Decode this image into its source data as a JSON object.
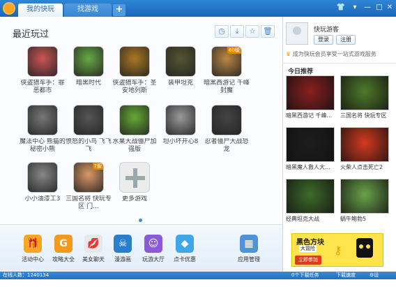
{
  "tabs": [
    "我的快玩",
    "找游戏"
  ],
  "main": {
    "section_title": "最近玩过",
    "games": [
      {
        "name": "侠盗猎车手：罪恶都市",
        "badge": ""
      },
      {
        "name": "暗黑时代",
        "badge": ""
      },
      {
        "name": "侠盗猎车手：圣安地列斯",
        "badge": ""
      },
      {
        "name": "装甲坦克",
        "badge": ""
      },
      {
        "name": "暗黑西游记 千峰封魔",
        "badge": "60级"
      },
      {
        "name": "魔法中心 熊猫的秘密小熊",
        "badge": ""
      },
      {
        "name": "愤怒的小鸟 飞飞飞",
        "badge": ""
      },
      {
        "name": "水果大战僵尸加强版",
        "badge": ""
      },
      {
        "name": "坦小坏开心8",
        "badge": ""
      },
      {
        "name": "忍者僵尸大战恐龙",
        "badge": ""
      },
      {
        "name": "小小油漆工3",
        "badge": ""
      },
      {
        "name": "三国名将 快玩专区 门...",
        "badge": "7服"
      },
      {
        "name": "更多游戏",
        "badge": ""
      }
    ]
  },
  "bottom": [
    {
      "label": "活动中心",
      "icon": "gift-icon",
      "color": "#f5a623",
      "glyph": "🎁"
    },
    {
      "label": "攻略大全",
      "icon": "guide-icon",
      "color": "#f39a1e",
      "glyph": "G"
    },
    {
      "label": "美女聊天",
      "icon": "lips-icon",
      "color": "#e8e8e8",
      "glyph": "💋"
    },
    {
      "label": "漫游画",
      "icon": "pirate-icon",
      "color": "#2b7ec9",
      "glyph": "☠"
    },
    {
      "label": "玩游大厅",
      "icon": "smile-icon",
      "color": "#8b5ad8",
      "glyph": "☺"
    },
    {
      "label": "点卡优惠",
      "icon": "diamond-icon",
      "color": "#3fa6e8",
      "glyph": "◆"
    },
    {
      "label": "应用管理",
      "icon": "apps-grid-icon",
      "color": "#4f92d8",
      "glyph": "▦"
    }
  ],
  "side": {
    "username": "快玩游客",
    "login": "登录",
    "register": "注册",
    "member_text": "成为快玩会员享受一站式游戏服务",
    "recommend_title": "今日推荐",
    "recommend": [
      "暗黑西游记 千峰...",
      "三国名将 快玩专区",
      "暗黑魔人救人大...",
      "火柴人点击死亡2",
      "经典坦克大战",
      "蜗牛鲍勃5"
    ],
    "ad": {
      "title": "黑色方块",
      "subtitle": "大冒险",
      "button": "立即参加"
    }
  },
  "status": {
    "online": "在线人数：1240134",
    "downloads": "0个下载任务",
    "progress_label": "下载速度",
    "settings": "设置"
  },
  "colors": {
    "accent": "#2b7ec9",
    "brand": "#f7a623"
  }
}
